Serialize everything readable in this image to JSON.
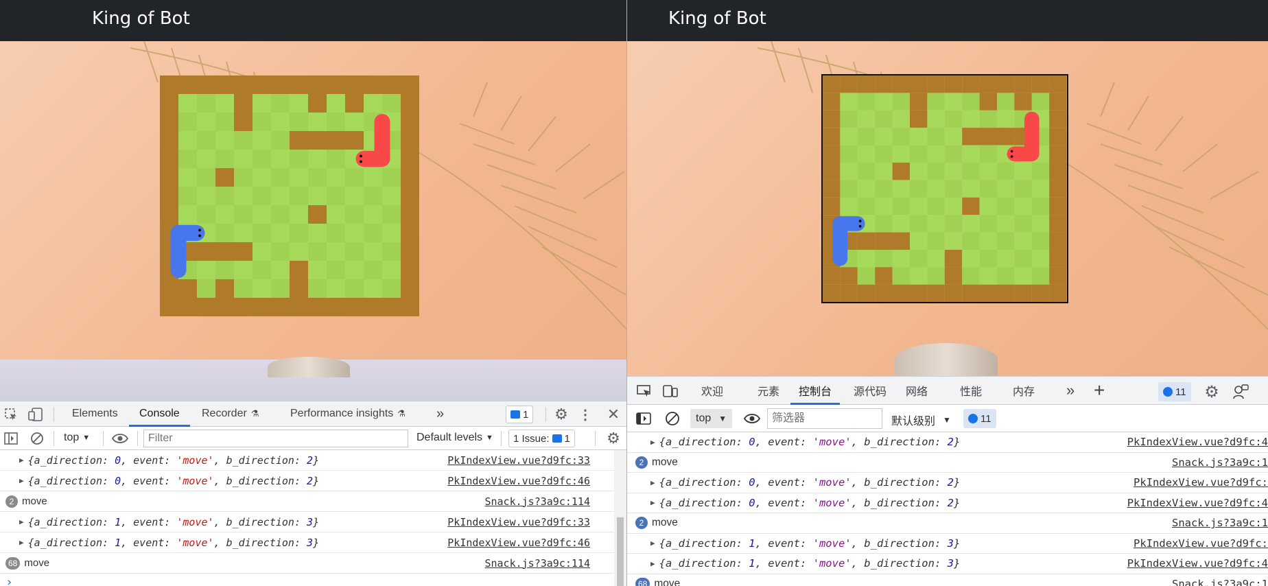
{
  "app": {
    "title": "King of Bot"
  },
  "colors": {
    "header": "#212529",
    "wall": "#b07a2b",
    "grass_light": "#a7d95a",
    "grass_dark": "#a0d152",
    "snake_a": "#4876ec",
    "snake_b": "#f94848"
  },
  "left_devtools": {
    "tabs": [
      "Elements",
      "Console",
      "Recorder",
      "Performance insights"
    ],
    "active_tab": "Console",
    "more": "»",
    "issues_badge": "1",
    "context": "top",
    "filter_placeholder": "Filter",
    "levels": "Default levels",
    "issue_text": "1 Issue:",
    "issue_count": "1",
    "logs": [
      {
        "kind": "obj",
        "a": "0",
        "event": "'move'",
        "b": "2",
        "src": "PkIndexView.vue?d9fc:33"
      },
      {
        "kind": "obj",
        "a": "0",
        "event": "'move'",
        "b": "2",
        "src": "PkIndexView.vue?d9fc:46"
      },
      {
        "kind": "text",
        "count": "2",
        "text": "move",
        "src": "Snack.js?3a9c:114"
      },
      {
        "kind": "obj",
        "a": "1",
        "event": "'move'",
        "b": "3",
        "src": "PkIndexView.vue?d9fc:33"
      },
      {
        "kind": "obj",
        "a": "1",
        "event": "'move'",
        "b": "3",
        "src": "PkIndexView.vue?d9fc:46"
      },
      {
        "kind": "text",
        "count": "68",
        "text": "move",
        "src": "Snack.js?3a9c:114"
      }
    ],
    "prompt": "›"
  },
  "right_devtools": {
    "tabs": [
      "欢迎",
      "元素",
      "控制台",
      "源代码",
      "网络",
      "性能",
      "内存"
    ],
    "active_tab": "控制台",
    "more": "»",
    "add": "+",
    "issues_badge": "11",
    "context": "top",
    "filter_placeholder": "筛选器",
    "levels": "默认级别",
    "issue_count": "11",
    "logs": [
      {
        "kind": "obj",
        "a": "0",
        "event": "'move'",
        "b": "2",
        "src": "PkIndexView.vue?d9fc:4"
      },
      {
        "kind": "text",
        "count": "2",
        "text": "move",
        "src": "Snack.js?3a9c:1"
      },
      {
        "kind": "obj",
        "a": "0",
        "event": "'move'",
        "b": "2",
        "src": "PkIndexView.vue?d9fc:"
      },
      {
        "kind": "obj",
        "a": "0",
        "event": "'move'",
        "b": "2",
        "src": "PkIndexView.vue?d9fc:4"
      },
      {
        "kind": "text",
        "count": "2",
        "text": "move",
        "src": "Snack.js?3a9c:1"
      },
      {
        "kind": "obj",
        "a": "1",
        "event": "'move'",
        "b": "3",
        "src": "PkIndexView.vue?d9fc:"
      },
      {
        "kind": "obj",
        "a": "1",
        "event": "'move'",
        "b": "3",
        "src": "PkIndexView.vue?d9fc:4"
      },
      {
        "kind": "text",
        "count": "68",
        "text": "move",
        "src": "Snack.js?3a9c:1"
      }
    ]
  }
}
